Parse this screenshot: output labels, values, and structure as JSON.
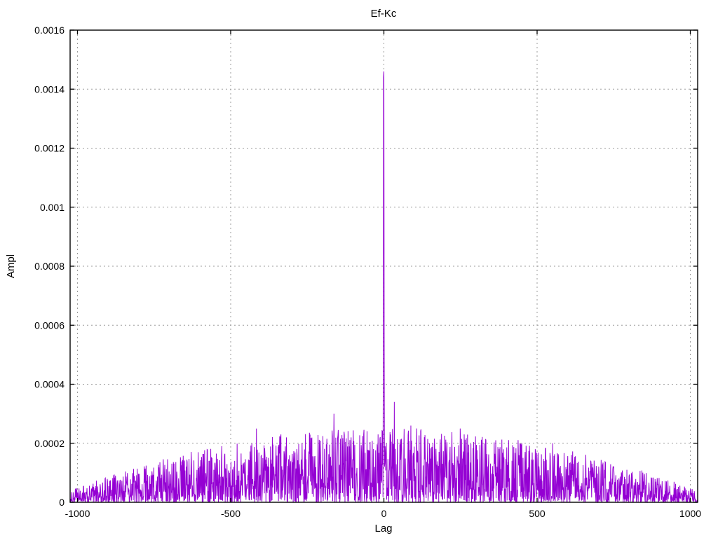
{
  "chart_data": {
    "type": "line",
    "title": "Ef-Kc",
    "xlabel": "Lag",
    "ylabel": "Ampl",
    "legend": "none",
    "style": "gnuplot dense noisy cross-correlation trace with sharp central peak",
    "background_color": "#ffffff",
    "border_color": "#000000",
    "grid": {
      "show": true,
      "color": "#9c9c9c",
      "dash": "2,4"
    },
    "line_color": "#9400d3",
    "xlim": [
      -1024,
      1024
    ],
    "ylim": [
      0,
      0.0016
    ],
    "xticks": [
      {
        "value": -1000,
        "label": "-1000"
      },
      {
        "value": -500,
        "label": "-500"
      },
      {
        "value": 0,
        "label": "0"
      },
      {
        "value": 500,
        "label": "500"
      },
      {
        "value": 1000,
        "label": "1000"
      }
    ],
    "yticks": [
      {
        "value": 0,
        "label": "0"
      },
      {
        "value": 0.0002,
        "label": "0.0002"
      },
      {
        "value": 0.0004,
        "label": "0.0004"
      },
      {
        "value": 0.0006,
        "label": "0.0006"
      },
      {
        "value": 0.0008,
        "label": "0.0008"
      },
      {
        "value": 0.001,
        "label": "0.001"
      },
      {
        "value": 0.0012,
        "label": "0.0012"
      },
      {
        "value": 0.0014,
        "label": "0.0014"
      },
      {
        "value": 0.0016,
        "label": "0.0016"
      }
    ],
    "main_peak": {
      "lag": 0,
      "value": 0.00146
    },
    "notable_spikes": [
      [
        -416,
        0.00025
      ],
      [
        -336,
        0.00023
      ],
      [
        -267,
        0.0002
      ],
      [
        -163,
        0.0003
      ],
      [
        -107,
        0.00022
      ],
      [
        -2,
        0.0005
      ],
      [
        -1,
        0.00144
      ],
      [
        0,
        0.00146
      ],
      [
        1,
        0.00055
      ],
      [
        34,
        0.00034
      ],
      [
        88,
        0.00026
      ],
      [
        107,
        0.00025
      ],
      [
        249,
        0.00025
      ],
      [
        444,
        0.0002
      ],
      [
        551,
        0.0002
      ]
    ],
    "noise_model": {
      "seed": 1187,
      "lag_min": -1023,
      "lag_max": 1023,
      "envelope_base": 4e-05,
      "envelope_scale": 0.00021,
      "envelope_power": 2,
      "value_shape": 1.7,
      "description": "noise floor envelope: ~0.00025 max near lag 0 decaying parabolically to ~0.00005 at |lag|=1000"
    }
  }
}
